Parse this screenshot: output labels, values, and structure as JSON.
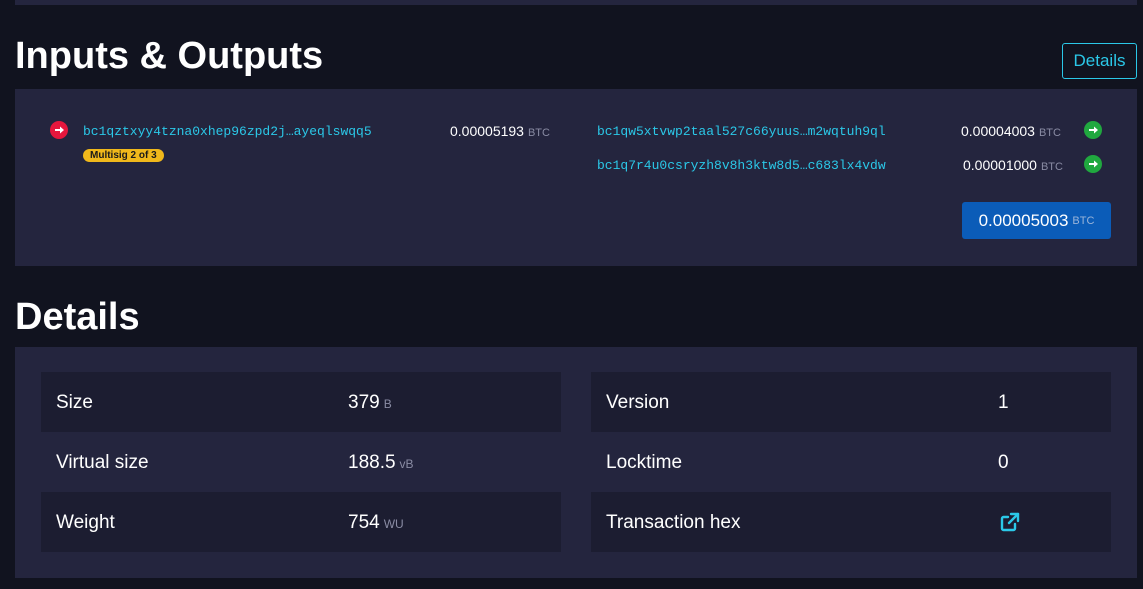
{
  "inputs_outputs": {
    "title": "Inputs & Outputs",
    "details_button": "Details",
    "inputs": [
      {
        "address": "bc1qztxyy4tzna0xhep96zpd2j…ayeqlswqq5",
        "amount": "0.00005193",
        "unit": "BTC",
        "badge": "Multisig 2 of 3"
      }
    ],
    "outputs": [
      {
        "address": "bc1qw5xtvwp2taal527c66yuus…m2wqtuh9ql",
        "amount": "0.00004003",
        "unit": "BTC"
      },
      {
        "address": "bc1q7r4u0csryzh8v8h3ktw8d5…c683lx4vdw",
        "amount": "0.00001000",
        "unit": "BTC"
      }
    ],
    "total": {
      "amount": "0.00005003",
      "unit": "BTC"
    }
  },
  "details": {
    "title": "Details",
    "left_rows": [
      {
        "label": "Size",
        "value": "379",
        "unit": "B"
      },
      {
        "label": "Virtual size",
        "value": "188.5",
        "unit": "vB"
      },
      {
        "label": "Weight",
        "value": "754",
        "unit": "WU"
      }
    ],
    "right_rows": [
      {
        "label": "Version",
        "value": "1"
      },
      {
        "label": "Locktime",
        "value": "0"
      },
      {
        "label": "Transaction hex",
        "icon": "external-link-icon"
      }
    ]
  },
  "colors": {
    "background": "#11131f",
    "panel": "#24253e",
    "row_dark": "#1c1d31",
    "accent": "#2bc8e8",
    "input_icon": "#e5173d",
    "output_icon": "#20a83f",
    "badge": "#f0b81b",
    "total_button": "#0b5cb8"
  }
}
